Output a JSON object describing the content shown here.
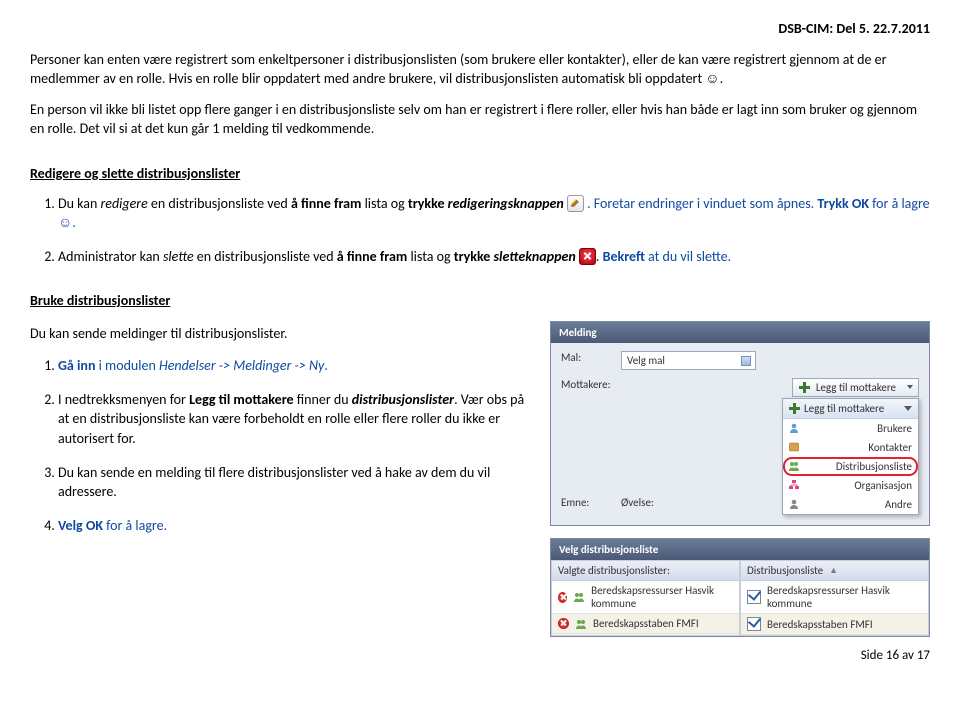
{
  "header_ref": "DSB-CIM: Del 5. 22.7.2011",
  "intro_p1": "Personer kan enten være registrert som enkeltpersoner i distribusjonslisten (som brukere eller kontakter), eller de kan være registrert gjennom at de er medlemmer av en rolle. Hvis en rolle blir oppdatert med andre brukere, vil distribusjonslisten automatisk bli oppdatert ☺.",
  "intro_p2": "En person vil ikke bli listet opp flere ganger i en distribusjonsliste selv om han er registrert i flere roller, eller hvis han både er lagt inn som bruker og gjennom en rolle. Det vil si at det kun går 1 melding til vedkommende.",
  "section1_title": "Redigere og slette distribusjonslister",
  "item1a": "Du kan ",
  "item1b": "redigere",
  "item1c": " en distribusjonsliste ved ",
  "item1d": "å finne fram",
  "item1e": " lista og ",
  "item1f": "trykke ",
  "item1g": "redigeringsknappen",
  "item1h": ". Foretar endringer i vinduet som åpnes. ",
  "item1i": "Trykk OK",
  "item1j": " for å lagre ☺.",
  "item2a": "Administrator kan ",
  "item2b": "slette",
  "item2c": " en distribusjonsliste ved ",
  "item2d": "å finne fram",
  "item2e": " lista og ",
  "item2f": "trykke ",
  "item2g": "sletteknappen",
  "item2h": ". ",
  "item2i": "Bekreft",
  "item2j": " at du vil slette.",
  "section2_title": "Bruke distribusjonslister",
  "section2_lead": "Du kan sende meldinger til distribusjonslister.",
  "b_item1a": "Gå inn",
  "b_item1b": " i modulen ",
  "b_item1c": "Hendelser -> Meldinger -> Ny",
  "b_item1d": ".",
  "b_item2a": "I nedtrekksmenyen for ",
  "b_item2b": "Legg til mottakere",
  "b_item2c": " finner du ",
  "b_item2d": "distribusjonslister",
  "b_item2e": ". Vær obs på at en distribusjonsliste kan være forbeholdt en rolle eller flere roller du ikke er autorisert for.",
  "b_item3": "Du kan sende en melding til flere distribusjonslister ved å hake av dem du vil adressere.",
  "b_item4a": "Velg OK",
  "b_item4b": " for å lagre.",
  "panel": {
    "title": "Melding",
    "mal_label": "Mal:",
    "mal_value": "Velg mal",
    "mottakere_label": "Mottakere:",
    "add_label": "Legg til mottakere",
    "menu": {
      "brukere": "Brukere",
      "kontakter": "Kontakter",
      "distribusjonsliste": "Distribusjonsliste",
      "organisasjon": "Organisasjon",
      "andre": "Andre"
    },
    "emne_label": "Emne:",
    "ovelse_label": "Øvelse:"
  },
  "panel2": {
    "title": "Velg distribusjonsliste",
    "left_hdr": "Valgte distribusjonslister:",
    "right_hdr": "Distribusjonsliste",
    "rows": [
      "Beredskapsressurser Hasvik kommune",
      "Beredskapsstaben FMFI"
    ]
  },
  "footer": "Side 16 av 17"
}
